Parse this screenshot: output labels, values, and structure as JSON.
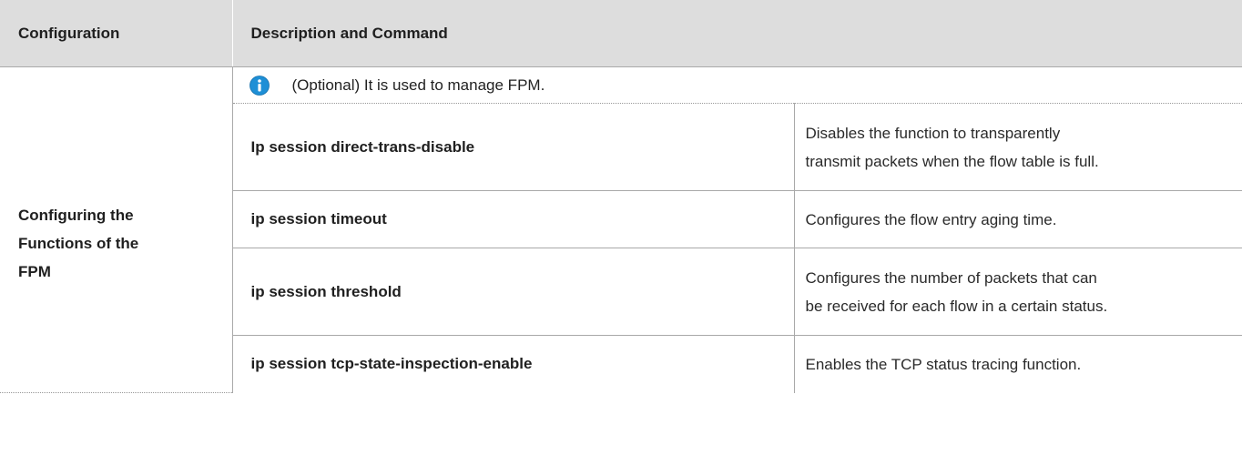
{
  "header": {
    "col1": "Configuration",
    "col2": "Description and Command"
  },
  "section": {
    "title_lines": [
      "Configuring the",
      "Functions of the",
      "FPM"
    ],
    "note": {
      "icon": "info-icon",
      "text": "(Optional) It is used to manage FPM."
    },
    "rows": [
      {
        "command": "Ip session direct-trans-disable",
        "description_lines": [
          "Disables the function to transparently",
          "transmit packets when the flow table is full."
        ]
      },
      {
        "command": "ip session timeout",
        "description_lines": [
          "Configures the flow entry aging time."
        ]
      },
      {
        "command": "ip session threshold",
        "description_lines": [
          "Configures the number of packets that can",
          "be received for each flow in a certain status."
        ]
      },
      {
        "command": "ip session tcp-state-inspection-enable",
        "description_lines": [
          "Enables the TCP status tracing function."
        ]
      }
    ]
  },
  "colors": {
    "header_bg": "#dddddd",
    "border": "#a9a9a9",
    "info_icon": "#1e8fd6"
  }
}
